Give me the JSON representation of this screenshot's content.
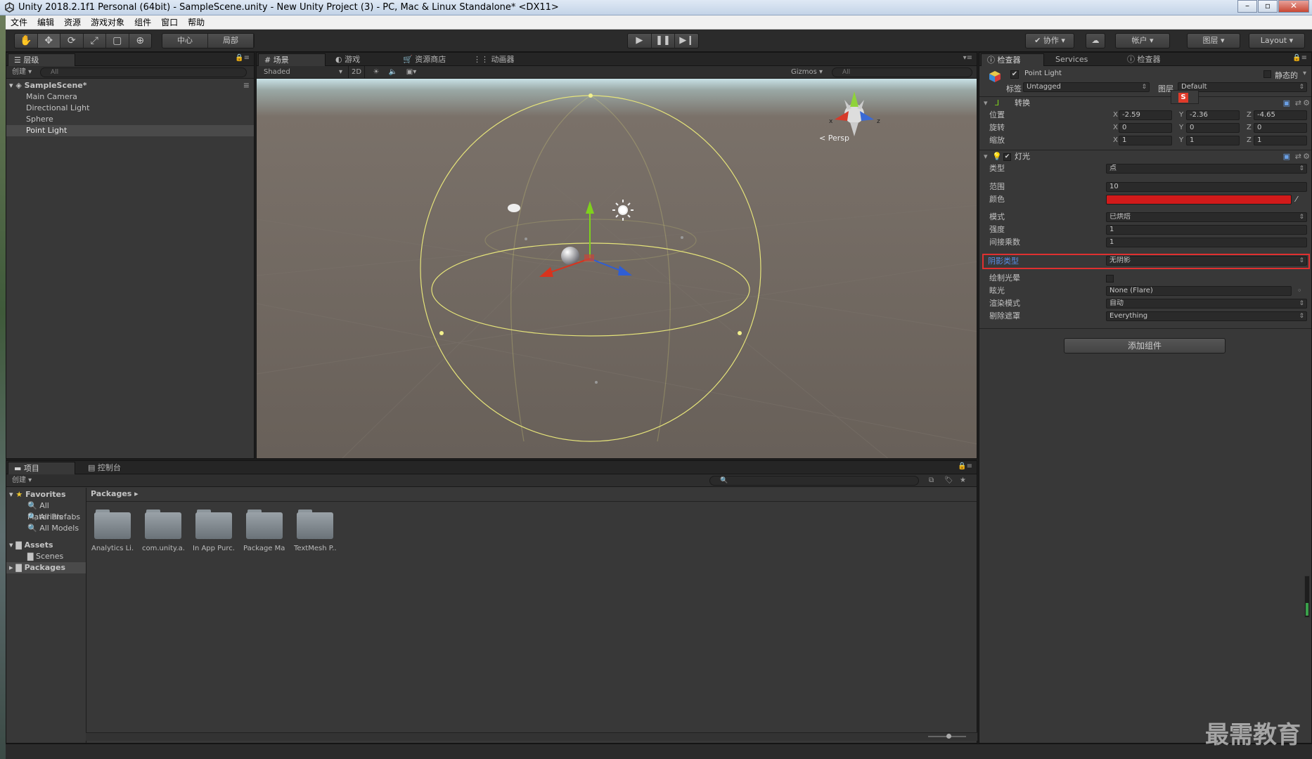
{
  "window": {
    "title": "Unity 2018.2.1f1 Personal (64bit) - SampleScene.unity - New Unity Project (3) - PC, Mac & Linux Standalone* <DX11>",
    "min": "–",
    "max": "▫",
    "close": "✕"
  },
  "menu": [
    "文件",
    "编辑",
    "资源",
    "游戏对象",
    "组件",
    "窗口",
    "帮助"
  ],
  "toolbar": {
    "tools": [
      "✋",
      "✥",
      "⟳",
      "⤢",
      "▢",
      "⊕"
    ],
    "pivot": "中心",
    "local": "局部",
    "play": "▶",
    "pause": "❚❚",
    "step": "▶❙",
    "collab": "协作",
    "account": "帐户",
    "layers": "图层",
    "layout": "Layout"
  },
  "hierarchy": {
    "tab": "层级",
    "create": "创建 ▾",
    "search": "All",
    "scene": "SampleScene*",
    "items": [
      "Main Camera",
      "Directional Light",
      "Sphere",
      "Point Light"
    ]
  },
  "scene": {
    "tabs": [
      "场景",
      "游戏",
      "资源商店",
      "动画器"
    ],
    "shading": "Shaded",
    "mode2d": "2D",
    "gizmos": "Gizmos",
    "search": "All",
    "persp": "Persp",
    "axis_x": "x",
    "axis_z": "z",
    "panel_menu": "▾≡"
  },
  "inspector": {
    "tabs": [
      "检查器",
      "Services",
      "检查器"
    ],
    "object_name": "Point Light",
    "static_label": "静态的",
    "tag_label": "标签",
    "tag_value": "Untagged",
    "layer_label": "图层",
    "layer_value": "Default",
    "transform": {
      "title": "转换",
      "rows": [
        {
          "label": "位置",
          "x": "-2.59",
          "y": "-2.36",
          "z": "-4.65"
        },
        {
          "label": "旋转",
          "x": "0",
          "y": "0",
          "z": "0"
        },
        {
          "label": "缩放",
          "x": "1",
          "y": "1",
          "z": "1"
        }
      ]
    },
    "axes": [
      "X",
      "Y",
      "Z"
    ],
    "light": {
      "title": "灯光",
      "type_label": "类型",
      "type_value": "点",
      "range_label": "范围",
      "range_value": "10",
      "color_label": "颜色",
      "color_value": "#d21a1a",
      "mode_label": "模式",
      "mode_value": "已烘焙",
      "intensity_label": "强度",
      "intensity_value": "1",
      "indirect_label": "间接乘数",
      "indirect_value": "1",
      "shadow_label": "阴影类型",
      "shadow_value": "无阴影",
      "halo_label": "绘制光晕",
      "flare_label": "眩光",
      "flare_value": "None (Flare)",
      "render_label": "渲染模式",
      "render_value": "自动",
      "culling_label": "剔除遮罩",
      "culling_value": "Everything"
    },
    "add_component": "添加组件"
  },
  "project": {
    "tabs": [
      "项目",
      "控制台"
    ],
    "create": "创建 ▾",
    "tree": {
      "favorites": "Favorites",
      "fav_items": [
        "All Materials",
        "All Prefabs",
        "All Models"
      ],
      "assets": "Assets",
      "scenes": "Scenes",
      "packages": "Packages"
    },
    "breadcrumb": "Packages ▸",
    "folders": [
      "Analytics Li...",
      "com.unity.a...",
      "In App Purc...",
      "Package Ma...",
      "TextMesh P..."
    ]
  },
  "watermark": "最需教育",
  "colors": {
    "highlight": "#e03030",
    "selection": "#3d6fb6",
    "light_color": "#d21a1a",
    "gizmo": "#e6e47a"
  }
}
